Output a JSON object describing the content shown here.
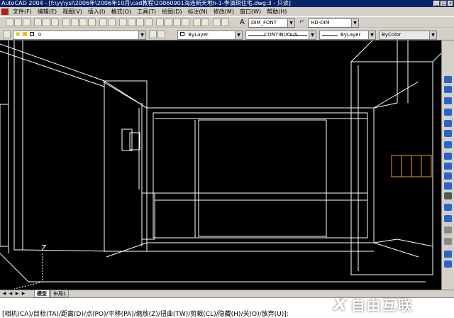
{
  "window": {
    "title": "AutoCAD 2004 - [f:\\yy\\ysl\\2006年\\2006年10月\\cad教程\\20060901海连新天地h-1-李演琪住宅.dwg:3 - 只读]"
  },
  "menu": {
    "items": [
      "文件(F)",
      "编辑(E)",
      "视图(V)",
      "插入(I)",
      "格式(O)",
      "工具(T)",
      "绘图(D)",
      "标注(N)",
      "修改(M)",
      "窗口(W)",
      "帮助(H)"
    ]
  },
  "toolbar": {
    "text_style": "DIM_FONT",
    "dim_style": "HD-DIM"
  },
  "properties": {
    "layer": "0",
    "color": "ByLayer",
    "linetype": "CONTINUOUS",
    "lineweight": "ByLayer",
    "plotstyle": "ByColor"
  },
  "drawing": {
    "ucs_label": "Z",
    "accent_color": "#e8a020"
  },
  "layout_tabs": {
    "tabs": [
      "模型",
      "布局1"
    ],
    "active": "模型"
  },
  "command_line": {
    "prompt": "[相机(CA)/目标(TA)/距离(D)/点(PO)/平移(PA)/缩放(Z)/扭曲(TW)/剪裁(CL)/隐藏(H)/关(O)/放弃(U)]:"
  },
  "watermark": {
    "text": "自由互联"
  }
}
